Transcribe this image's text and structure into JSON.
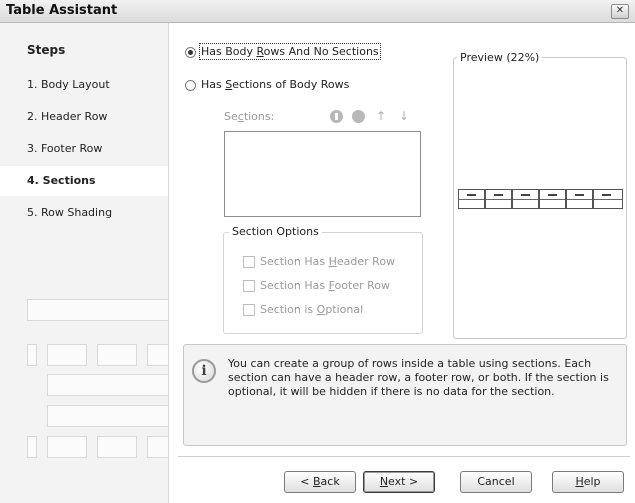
{
  "window": {
    "title": "Table Assistant",
    "close_glyph": "✕"
  },
  "sidebar": {
    "heading": "Steps",
    "items": [
      {
        "label": "1. Body Layout"
      },
      {
        "label": "2. Header Row"
      },
      {
        "label": "3. Footer Row"
      },
      {
        "label": "4. Sections",
        "active": true
      },
      {
        "label": "5. Row Shading"
      }
    ]
  },
  "layout_options": {
    "option1": {
      "pre": "Has Body ",
      "mnemonic": "R",
      "post": "ows And No Sections",
      "selected": true
    },
    "option2": {
      "pre": "Has ",
      "mnemonic": "S",
      "post": "ections of Body Rows",
      "selected": false
    }
  },
  "sections": {
    "label_pre": "Se",
    "label_mnemonic": "c",
    "label_post": "tions:",
    "icons": [
      "add-section-icon",
      "remove-section-icon",
      "move-up-icon",
      "move-down-icon"
    ],
    "items": []
  },
  "section_options": {
    "title": "Section Options",
    "checkboxes": [
      {
        "pre": "Section Has ",
        "mnemonic": "H",
        "post": "eader Row",
        "checked": false
      },
      {
        "pre": "Section Has ",
        "mnemonic": "F",
        "post": "ooter Row",
        "checked": false
      },
      {
        "pre": "Section is ",
        "mnemonic": "O",
        "post": "ptional",
        "checked": false
      }
    ]
  },
  "preview": {
    "title": "Preview (22%)"
  },
  "info": {
    "icon": "info-icon",
    "text": "You can create a group of rows inside a table using sections. Each section can have a header row, a footer row, or both. If the section is optional, it will be hidden if there is no data for the section."
  },
  "buttons": {
    "back": {
      "pre": "< ",
      "mnemonic": "B",
      "post": "ack"
    },
    "next": {
      "pre": "",
      "mnemonic": "N",
      "post": "ext >"
    },
    "cancel": {
      "label": "Cancel"
    },
    "help": {
      "pre": "",
      "mnemonic": "H",
      "post": "elp"
    }
  }
}
